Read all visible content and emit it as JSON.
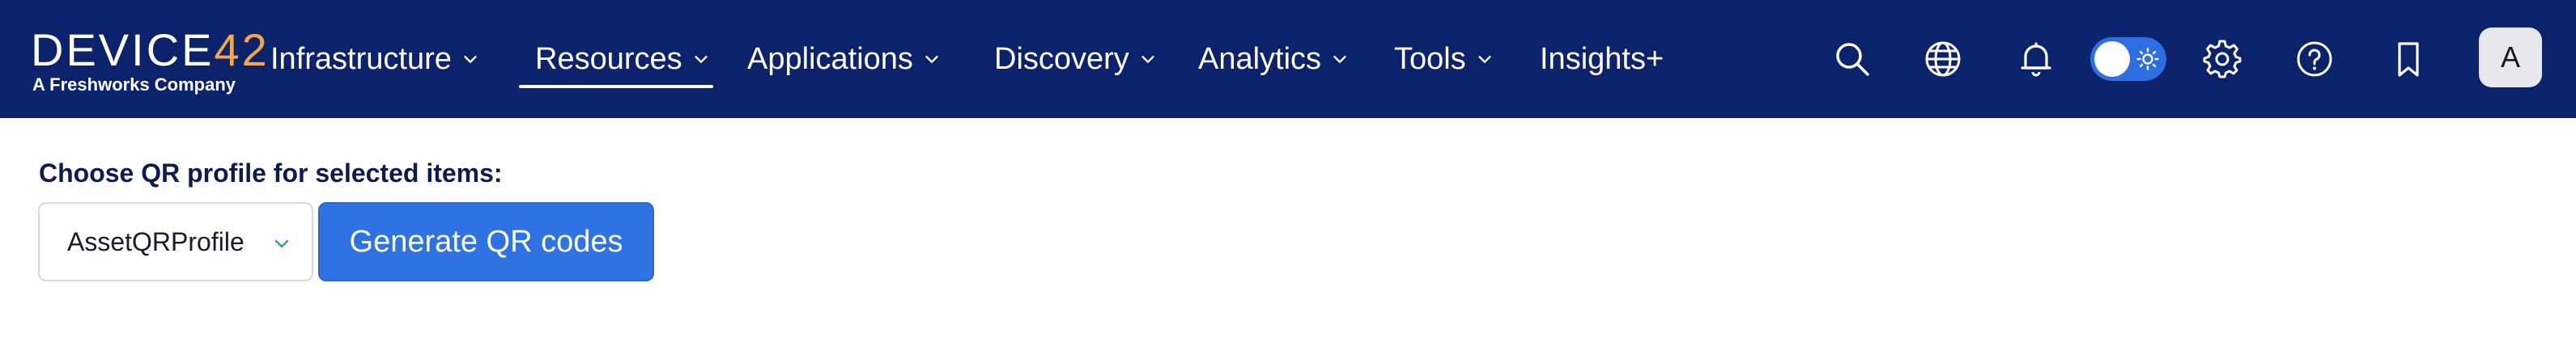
{
  "brand": {
    "name_part1": "DEVIC",
    "name_part2": "E",
    "name_part3": "42",
    "tagline": "A Freshworks Company",
    "accent_color": "#f0a74a"
  },
  "nav": {
    "background": "#0c226a",
    "items": [
      {
        "label": "Infrastructure",
        "has_dropdown": true,
        "active": false
      },
      {
        "label": "Resources",
        "has_dropdown": true,
        "active": true
      },
      {
        "label": "Applications",
        "has_dropdown": true,
        "active": false
      },
      {
        "label": "Discovery",
        "has_dropdown": true,
        "active": false
      },
      {
        "label": "Analytics",
        "has_dropdown": true,
        "active": false
      },
      {
        "label": "Tools",
        "has_dropdown": true,
        "active": false
      },
      {
        "label": "Insights+",
        "has_dropdown": false,
        "active": false
      }
    ],
    "icons": [
      "search-icon",
      "globe-icon",
      "bell-icon",
      "theme-toggle",
      "gear-icon",
      "help-icon",
      "bookmark-icon"
    ],
    "theme_toggle_on": true,
    "avatar_initial": "A"
  },
  "qr": {
    "label": "Choose QR profile for selected items:",
    "selected_profile": "AssetQRProfile",
    "generate_label": "Generate QR codes",
    "button_color": "#2f73e2"
  }
}
